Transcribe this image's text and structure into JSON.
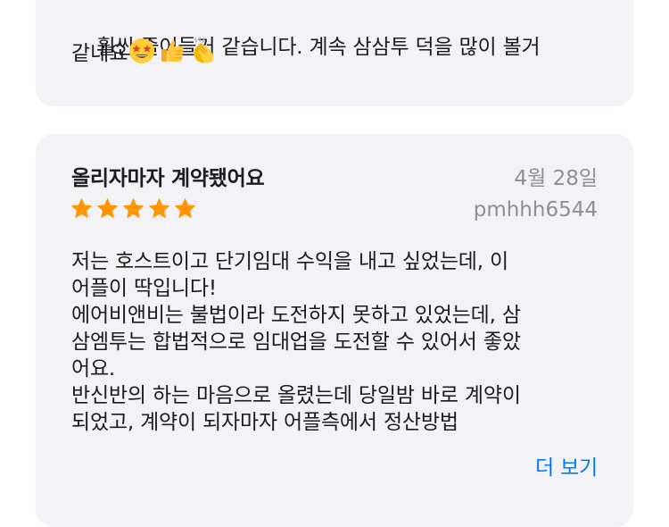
{
  "prev_review": {
    "line1": "훨씬 줄어들거 같습니다. 계속 삼삼투 덕을 많이 볼거",
    "line2": "같네요",
    "emojis": [
      "star-struck-emoji",
      "thumbs-up-emoji",
      "clapping-hands-emoji"
    ]
  },
  "review": {
    "title": "올리자마자 계약됐어요",
    "date": "4월 28일",
    "author": "pmhhh6544",
    "rating": 5,
    "rating_max": 5,
    "star_color": "#ff9500",
    "body": "저는 호스트이고 단기임대 수익을 내고 싶었는데, 이\n어플이 딱입니다!\n에어비앤비는 불법이라 도전하지 못하고 있었는데, 삼\n삼엠투는 합법적으로 임대업을 도전할 수 있어서 좋았\n어요.\n반신반의 하는 마음으로 올렸는데 당일밤 바로 계약이\n되었고, 계약이 되자마자 어플측에서 정산방법",
    "more_label": "더 보기"
  },
  "colors": {
    "card_bg": "#f2f2f7",
    "secondary_text": "#8e8e93",
    "link": "#007aff"
  }
}
